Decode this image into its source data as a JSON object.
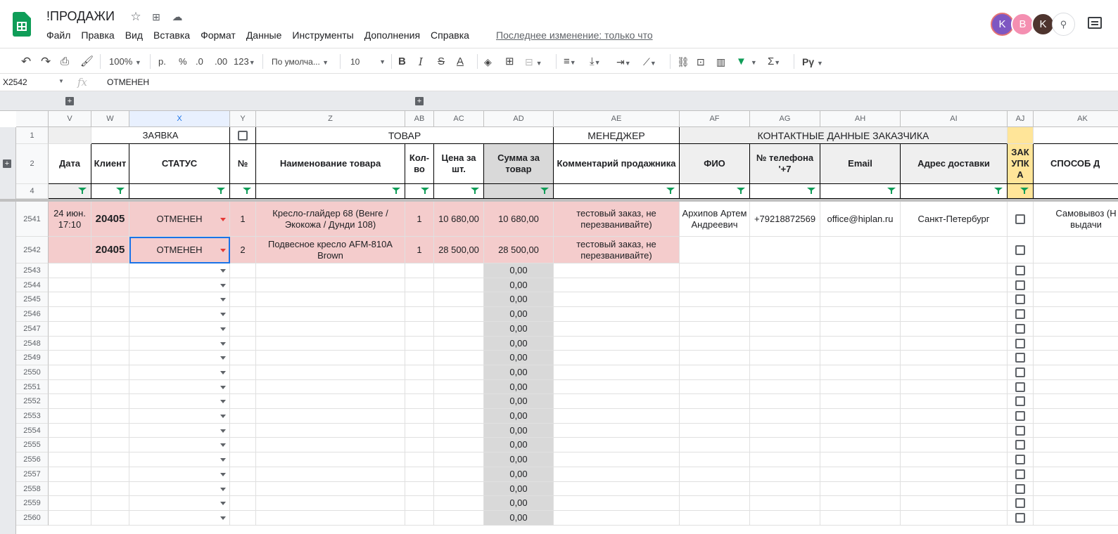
{
  "header": {
    "title": "!ПРОДАЖИ",
    "last_edit": "Последнее изменение: только что"
  },
  "menu": [
    "Файл",
    "Правка",
    "Вид",
    "Вставка",
    "Формат",
    "Данные",
    "Инструменты",
    "Дополнения",
    "Справка"
  ],
  "avatars": [
    {
      "letter": "K",
      "color": "#7e57c2",
      "ring": "#e57373"
    },
    {
      "letter": "B",
      "color": "#f48fb1",
      "ring": "#fff"
    },
    {
      "letter": "K",
      "color": "#4e342e",
      "ring": "#fff"
    }
  ],
  "toolbar": {
    "zoom": "100%",
    "currency": "р.",
    "percent": "%",
    "dec_less": ".0",
    "dec_more": ".00",
    "format_more": "123",
    "font": "По умолча...",
    "font_size": "10",
    "bold": "B",
    "italic": "I",
    "strike": "S",
    "textcolor": "A",
    "sigma": "Σ",
    "script": "Pγ"
  },
  "formula": {
    "cell": "X2542",
    "fx": "fx",
    "value": "ОТМЕНЕН"
  },
  "columns": [
    "V",
    "W",
    "X",
    "Y",
    "Z",
    "AB",
    "AC",
    "AD",
    "AE",
    "AF",
    "AG",
    "AH",
    "AI",
    "AJ",
    "AK"
  ],
  "group_headers": {
    "zayavka": "ЗАЯВКА",
    "tovar": "ТОВАР",
    "manager": "МЕНЕДЖЕР",
    "contacts": "КОНТАКТНЫЕ ДАННЫЕ ЗАКАЗЧИКА"
  },
  "headers": [
    "Дата",
    "Клиент",
    "СТАТУС",
    "№",
    "Наименование товара",
    "Кол-во",
    "Цена за шт.",
    "Сумма за товар",
    "Комментарий продажника",
    "ФИО",
    "№ телефона '+7",
    "Email",
    "Адрес доставки",
    "ЗАК УПК А",
    "СПОСОБ Д"
  ],
  "row_labels": {
    "r1": "1",
    "r2": "2",
    "r4": "4"
  },
  "rows": [
    {
      "n": "2541",
      "date": "24 июн. 17:10",
      "client": "20405",
      "status": "ОТМЕНЕН",
      "num": "1",
      "product": "Кресло-глайдер 68 (Венге / Экокожа / Дунди 108)",
      "qty": "1",
      "price": "10 680,00",
      "sum": "10 680,00",
      "comment": "тестовый заказ, не перезванивайте)",
      "fio": "Архипов Артем Андреевич",
      "phone": "+79218872569",
      "email": "office@hiplan.ru",
      "address": "Санкт-Петербург",
      "delivery": "Самовывоз (Н выдачи"
    },
    {
      "n": "2542",
      "date": "",
      "client": "20405",
      "status": "ОТМЕНЕН",
      "num": "2",
      "product": "Подвесное кресло AFM-810A Brown",
      "qty": "1",
      "price": "28 500,00",
      "sum": "28 500,00",
      "comment": "тестовый заказ, не перезванивайте)",
      "fio": "",
      "phone": "",
      "email": "",
      "address": "",
      "delivery": ""
    }
  ],
  "empty_rows": [
    "2543",
    "2544",
    "2545",
    "2546",
    "2547",
    "2548",
    "2549",
    "2550",
    "2551",
    "2552",
    "2553",
    "2554",
    "2555",
    "2556",
    "2557",
    "2558",
    "2559",
    "2560"
  ],
  "empty_sum": "0,00"
}
